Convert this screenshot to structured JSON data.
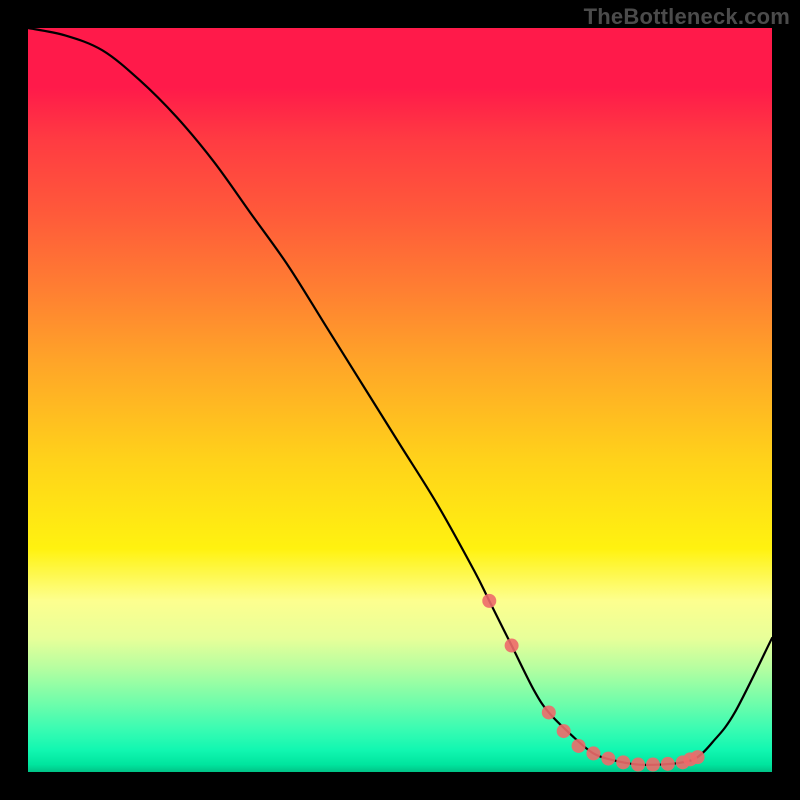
{
  "watermark": "TheBottleneck.com",
  "chart_data": {
    "type": "line",
    "title": "",
    "xlabel": "",
    "ylabel": "",
    "xlim": [
      0,
      100
    ],
    "ylim": [
      0,
      100
    ],
    "series": [
      {
        "name": "bottleneck-curve",
        "x": [
          0,
          5,
          10,
          15,
          20,
          25,
          30,
          35,
          40,
          45,
          50,
          55,
          60,
          62,
          65,
          68,
          70,
          73,
          76,
          79,
          82,
          85,
          88,
          90,
          92,
          95,
          100
        ],
        "y": [
          100,
          99,
          97,
          93,
          88,
          82,
          75,
          68,
          60,
          52,
          44,
          36,
          27,
          23,
          17,
          11,
          8,
          5,
          2.5,
          1.5,
          1,
          1,
          1.3,
          2,
          4,
          8,
          18
        ]
      }
    ],
    "markers": {
      "name": "highlight-dots",
      "x": [
        62,
        65,
        70,
        72,
        74,
        76,
        78,
        80,
        82,
        84,
        86,
        88,
        89,
        90
      ],
      "y": [
        23,
        17,
        8,
        5.5,
        3.5,
        2.5,
        1.8,
        1.3,
        1,
        1,
        1.1,
        1.3,
        1.7,
        2
      ],
      "color": "#ed6a6a",
      "radius": 7
    },
    "gradient_stops": [
      {
        "pos": 0,
        "color": "#ff1a4a"
      },
      {
        "pos": 50,
        "color": "#ffc81e"
      },
      {
        "pos": 75,
        "color": "#fff210"
      },
      {
        "pos": 100,
        "color": "#00c386"
      }
    ]
  }
}
